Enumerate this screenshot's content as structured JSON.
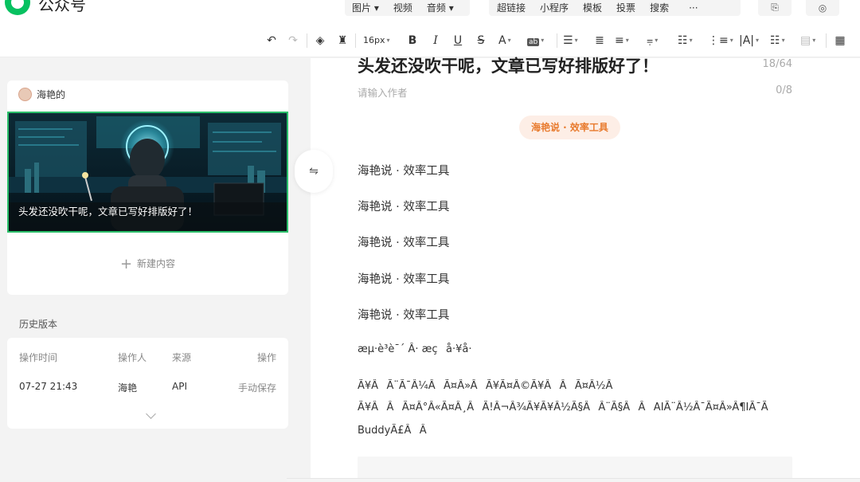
{
  "header": {
    "brand": "公众号",
    "media_menu": [
      "图片",
      "视频",
      "音频"
    ],
    "insert_menu": [
      "超链接",
      "小程序",
      "模板",
      "投票",
      "搜索"
    ],
    "more": "···"
  },
  "toolbar": {
    "font_size": "16px"
  },
  "sidebar": {
    "author_name": "海艳的",
    "cover_title": "头发还没吹干呢，文章已写好排版好了！",
    "new_content": "新建内容",
    "history": {
      "title": "历史版本",
      "headers": [
        "操作时间",
        "操作人",
        "来源",
        "操作"
      ],
      "rows": [
        [
          "07-27 21:43",
          "海艳",
          "API",
          "手动保存"
        ]
      ]
    }
  },
  "editor": {
    "title": "头发还没吹干呢，文章已写好排版好了！",
    "title_count": "18/64",
    "author_placeholder": "请输入作者",
    "author_count": "0/8",
    "tag": "海艳说 · 效率工具",
    "paragraphs": [
      "海艳说 · 效率工具",
      "海艳说 · 效率工具",
      "海艳说 · 效率工具",
      "海艳说 · 效率工具",
      "海艳说 · 效率工具"
    ],
    "garbled": [
      "æµ·è³è¯´ Â· æçå·¥å·",
      "Ã¥ÂÃ¨Ã¯Â¼ÂÃ¤Â»ÂÃ¥Ã¤Â©Ã¥ÂÂÃ¤Â½Â",
      "Ã¥ÂÂÃ¤Â°Â«Ã¤Â¸ÂÃ!Â¬Â¾Ã¥Ã¥Â½Ã§ÂÂ¨Ã§ÂÂAIÃ¨Â½Â¯Ã¤Â»Â¶IÃ¯Ã",
      "BuddyÃ£ÂÂ"
    ]
  },
  "colors": {
    "brand_green": "#07c160",
    "tag_bg": "#fdeee6",
    "tag_text": "#e87a2d",
    "cover_border": "#2bbf6a"
  }
}
